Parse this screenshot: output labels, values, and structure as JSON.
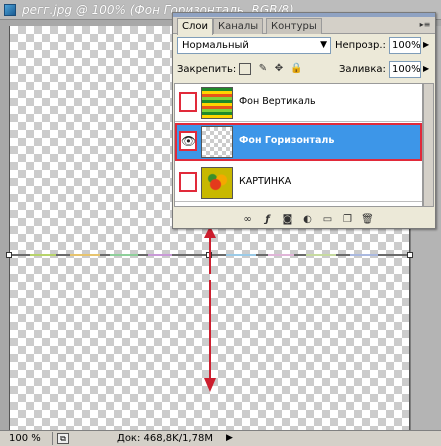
{
  "document": {
    "title": "регг.jpg @ 100% (Фон Горизонталь, RGB/8)"
  },
  "status_bar": {
    "zoom": "100 %",
    "doc_info": "Док: 468,8K/1,78M"
  },
  "layers_panel": {
    "tabs": [
      "Слои",
      "Каналы",
      "Контуры"
    ],
    "blend_mode": "Нормальный",
    "opacity_label": "Непрозр.:",
    "opacity_value": "100%",
    "lock_label": "Закрепить:",
    "fill_label": "Заливка:",
    "fill_value": "100%",
    "layers": [
      {
        "name": "Фон Вертикаль",
        "visible": false,
        "selected": false,
        "thumb": "stripes"
      },
      {
        "name": "Фон Горизонталь",
        "visible": true,
        "selected": true,
        "thumb": "transparent"
      },
      {
        "name": "КАРТИНКА",
        "visible": false,
        "selected": false,
        "thumb": "picture"
      }
    ]
  },
  "colors": {
    "selection_blue": "#3d96e8",
    "highlight_red": "#e12a3a",
    "arrow_red": "#cc1e2e"
  },
  "icons": [
    "ps-document-icon",
    "eye-icon",
    "link-layers-icon",
    "fx-icon",
    "mask-icon",
    "adjustment-icon",
    "folder-icon",
    "new-layer-icon",
    "trash-icon",
    "lock-transparency-icon",
    "lock-brush-icon",
    "lock-move-icon",
    "lock-all-icon"
  ]
}
